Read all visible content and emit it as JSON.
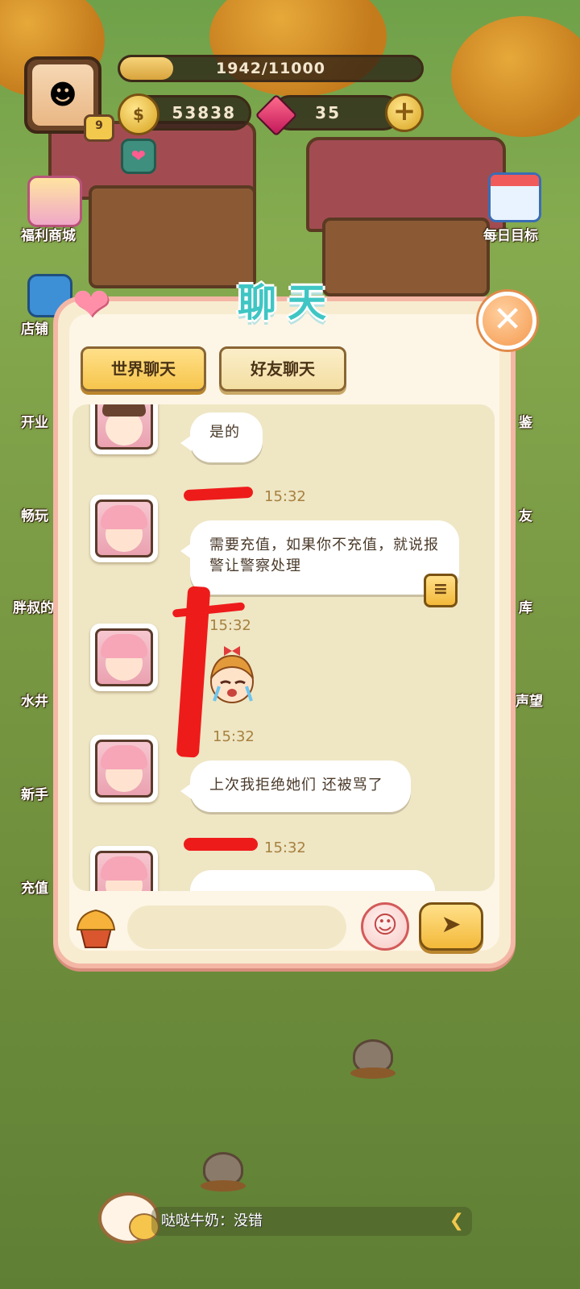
{
  "hud": {
    "level": "9",
    "xp_text": "1942/11000",
    "xp_fraction": 0.1765,
    "coins": "53838",
    "gems": "35"
  },
  "side_menu": {
    "left": [
      "福利商城",
      "店铺",
      "开业",
      "畅玩",
      "胖叔的",
      "水井",
      "新手",
      "充值"
    ],
    "right": [
      "每日目标",
      "鉴",
      "友",
      "库",
      "声望"
    ]
  },
  "chat": {
    "title": "聊天",
    "tabs": [
      {
        "label": "世界聊天",
        "active": true
      },
      {
        "label": "好友聊天",
        "active": false
      }
    ],
    "messages": [
      {
        "time": "",
        "text": "是的",
        "avatar": "brown-hair-avatar"
      },
      {
        "time": "15:32",
        "text": "需要充值，如果你不充值，就说报警让警察处理",
        "avatar": "pink-cat-avatar"
      },
      {
        "time": "15:32",
        "text": "",
        "avatar": "pink-cat-avatar",
        "sticker": "crying-girl-sticker"
      },
      {
        "time": "15:32",
        "text": "上次我拒绝她们 还被骂了",
        "avatar": "pink-cat-avatar"
      },
      {
        "time": "15:32",
        "text": "",
        "avatar": "pink-cat-avatar"
      }
    ],
    "input_placeholder": ""
  },
  "ticker": {
    "text": "哒哒牛奶：没错"
  },
  "colors": {
    "title": "#3fc6c4",
    "panel_border": "#f4b7a6",
    "redaction": "#ee1b1b",
    "tab_active": "#f6c54c"
  }
}
